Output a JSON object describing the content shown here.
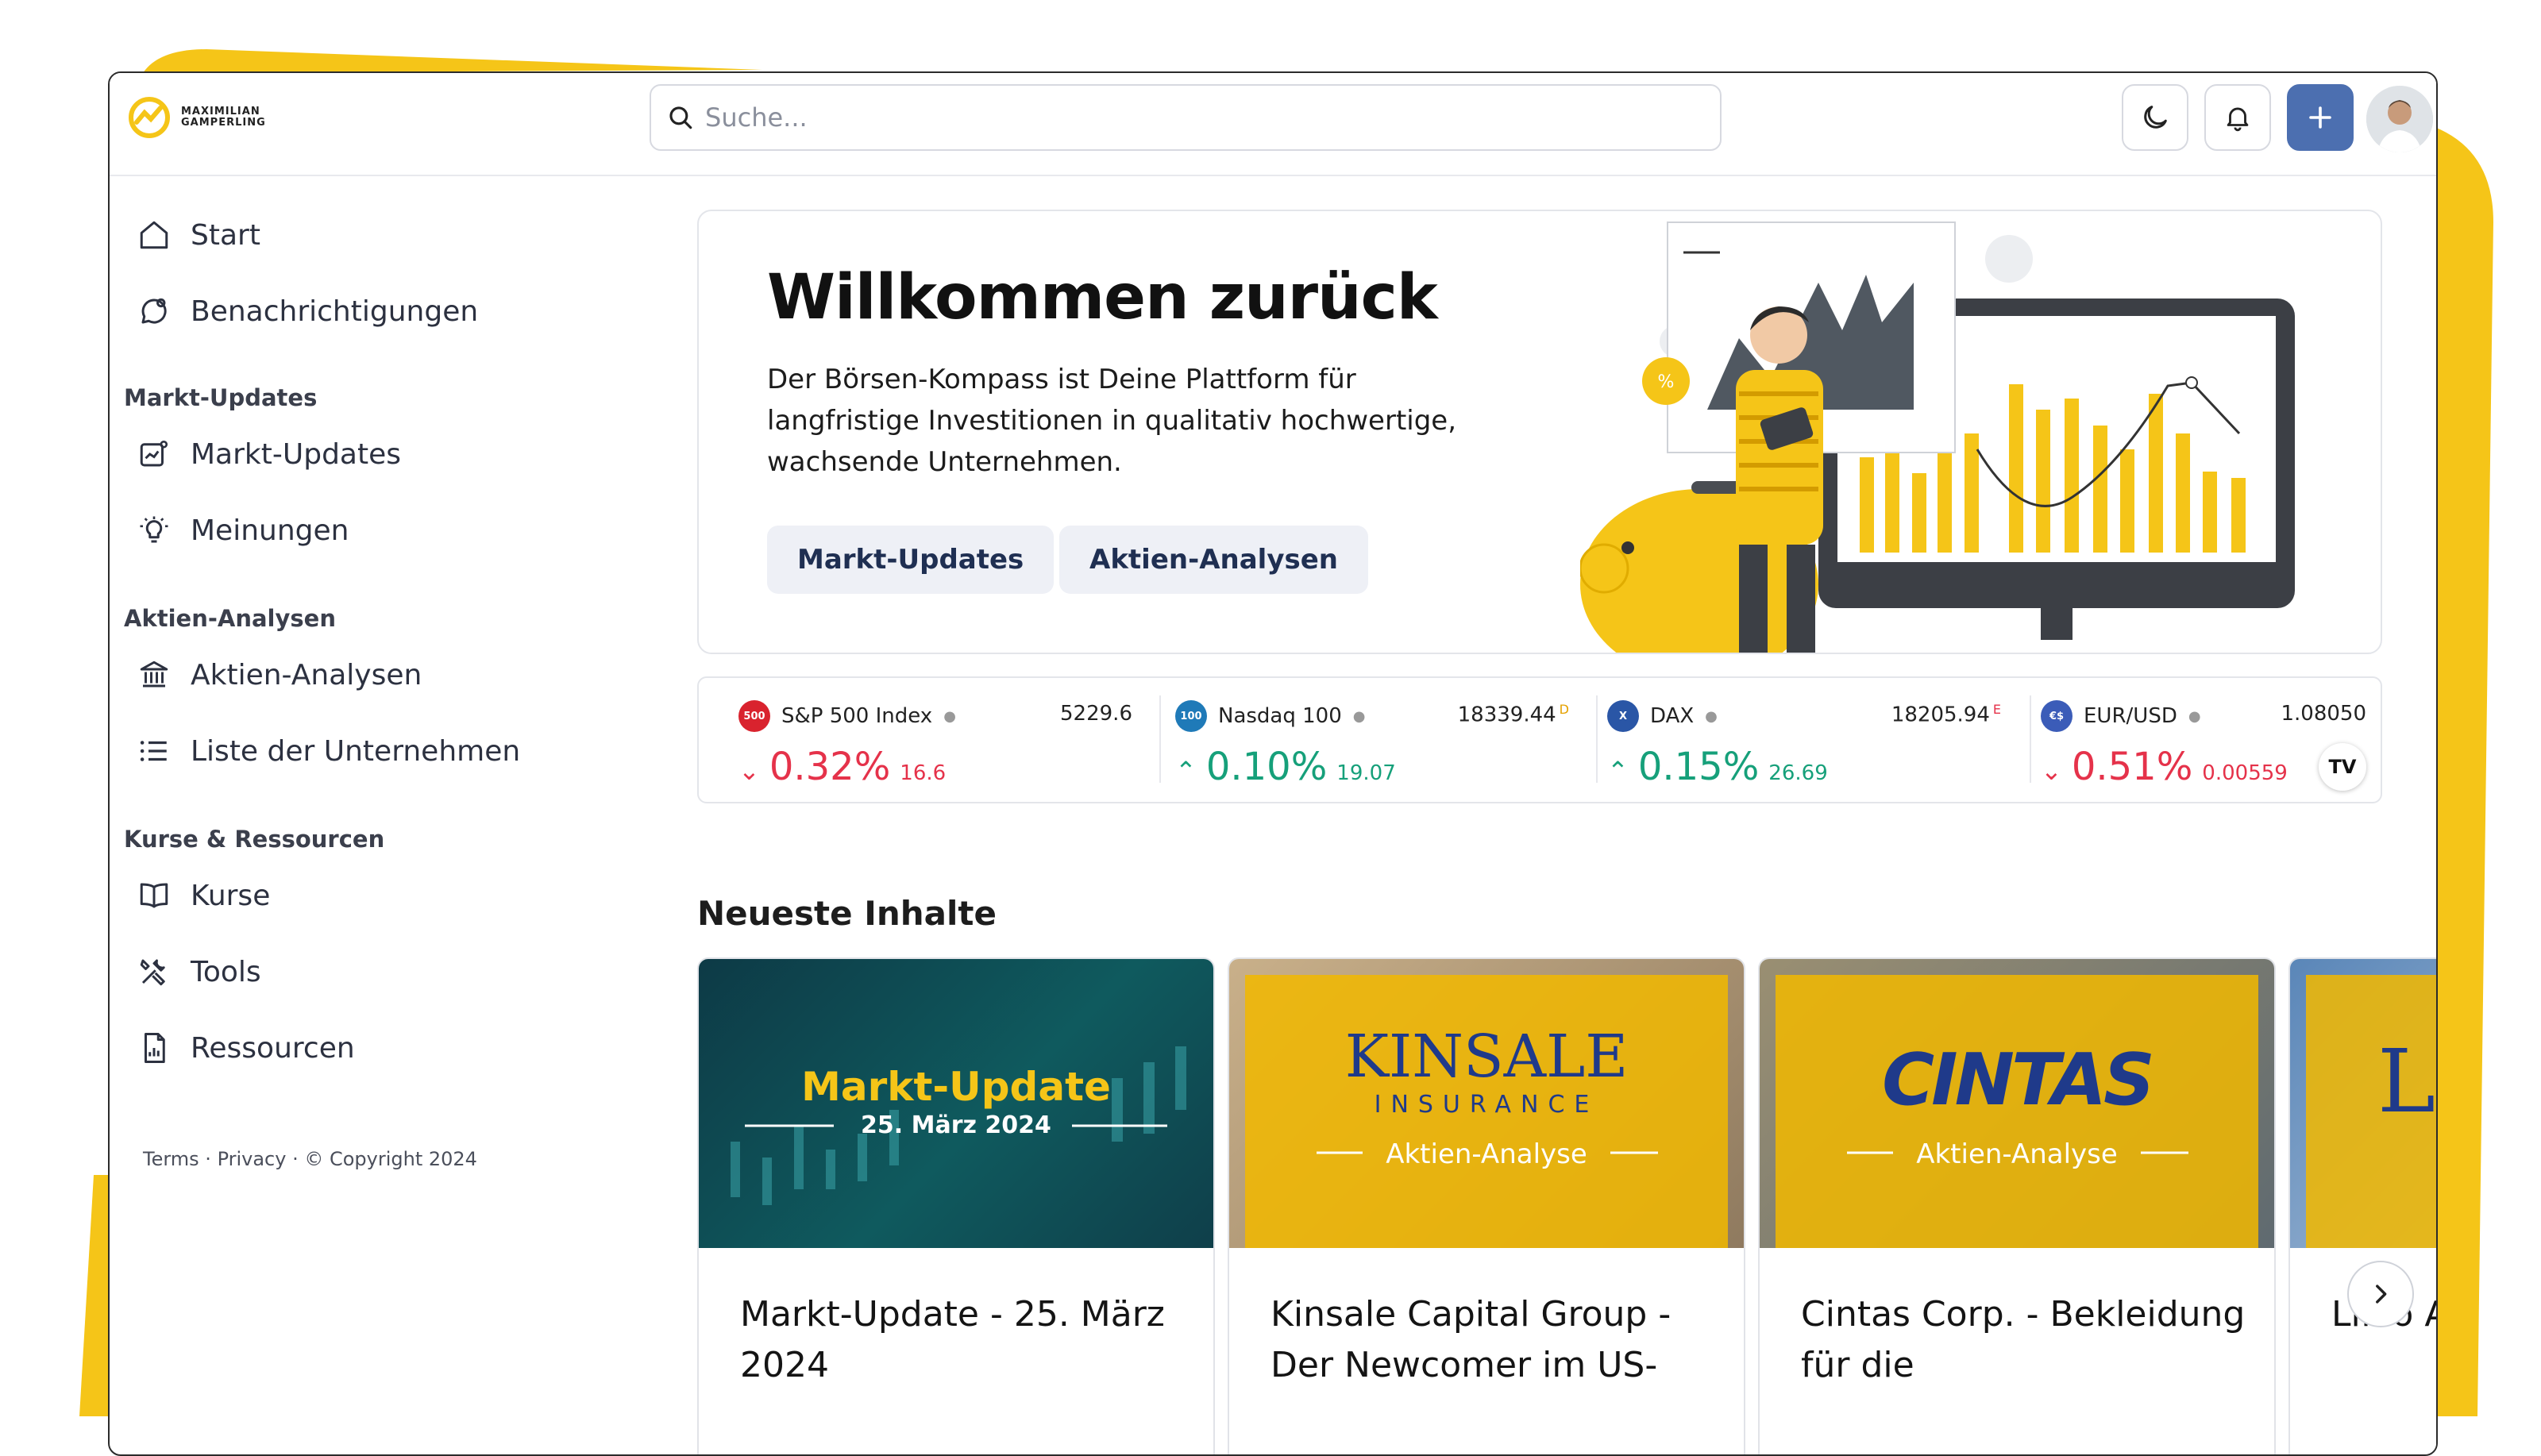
{
  "brand": {
    "logo_line1": "MAXIMILIAN",
    "logo_line2": "GAMPERLING",
    "accent": "#f5c518",
    "primary": "#4c6fb0"
  },
  "header": {
    "search_placeholder": "Suche..."
  },
  "sidebar": {
    "items": [
      {
        "label": "Start",
        "icon": "home-icon"
      },
      {
        "label": "Benachrichtigungen",
        "icon": "chat-bell-icon"
      }
    ],
    "sections": [
      {
        "title": "Markt-Updates",
        "items": [
          {
            "label": "Markt-Updates",
            "icon": "chart-update-icon"
          },
          {
            "label": "Meinungen",
            "icon": "lightbulb-icon"
          }
        ]
      },
      {
        "title": "Aktien-Analysen",
        "items": [
          {
            "label": "Aktien-Analysen",
            "icon": "bank-icon"
          },
          {
            "label": "Liste der Unternehmen",
            "icon": "list-icon"
          }
        ]
      },
      {
        "title": "Kurse & Ressourcen",
        "items": [
          {
            "label": "Kurse",
            "icon": "book-icon"
          },
          {
            "label": "Tools",
            "icon": "tools-icon"
          },
          {
            "label": "Ressourcen",
            "icon": "file-chart-icon"
          }
        ]
      }
    ],
    "footer": "Terms · Privacy · © Copyright 2024"
  },
  "welcome": {
    "title": "Willkommen zurück",
    "subtitle": "Der Börsen-Kompass ist Deine Plattform für langfristige Investitionen in qualitativ hochwertige, wachsende Unternehmen.",
    "button1": "Markt-Updates",
    "button2": "Aktien-Analysen"
  },
  "ticker": [
    {
      "badge": "500",
      "name": "S&P 500 Index",
      "price": "5229.6",
      "flag": "",
      "direction": "down",
      "pct": "0.32%",
      "abs": "16.6",
      "badge_color": "#d9232e"
    },
    {
      "badge": "100",
      "name": "Nasdaq 100",
      "price": "18339.44",
      "flag": "D",
      "direction": "up",
      "pct": "0.10%",
      "abs": "19.07",
      "badge_color": "#1f7ab8"
    },
    {
      "badge": "X",
      "name": "DAX",
      "price": "18205.94",
      "flag": "E",
      "direction": "up",
      "pct": "0.15%",
      "abs": "26.69",
      "badge_color": "#2a56a6"
    },
    {
      "badge": "€$",
      "name": "EUR/USD",
      "price": "1.08050",
      "flag": "",
      "direction": "down",
      "pct": "0.51%",
      "abs": "0.00559",
      "badge_color": "#3b5cb8"
    }
  ],
  "ticker_logo": "TV",
  "newest": {
    "heading": "Neueste Inhalte",
    "cards": [
      {
        "title": "Markt-Update - 25. März 2024",
        "img_title": "Markt-Update",
        "img_date": "25. März 2024"
      },
      {
        "title": "Kinsale Capital Group - Der Newcomer im US-",
        "img_brand": "KINSALE",
        "img_brand_sub": "INSURANCE",
        "img_tag": "Aktien-Analyse"
      },
      {
        "title": "Cintas Corp. - Bekleidung für die",
        "img_brand": "CINTAS",
        "img_tag": "Aktien-Analyse"
      },
      {
        "title": "Lifco A Serien",
        "img_brand": "L"
      }
    ]
  }
}
